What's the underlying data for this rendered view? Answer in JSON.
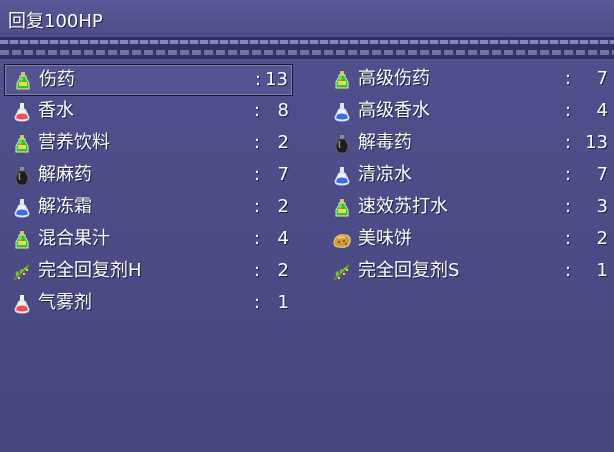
{
  "header": {
    "title": "回复100HP"
  },
  "inventory": {
    "left": [
      {
        "name": "伤药",
        "count": "13",
        "icon": "green-potion-icon"
      },
      {
        "name": "香水",
        "count": "8",
        "icon": "pink-perfume-icon"
      },
      {
        "name": "营养饮料",
        "count": "2",
        "icon": "green-potion-icon"
      },
      {
        "name": "解麻药",
        "count": "7",
        "icon": "black-potion-icon"
      },
      {
        "name": "解冻霜",
        "count": "2",
        "icon": "blue-potion-icon"
      },
      {
        "name": "混合果汁",
        "count": "4",
        "icon": "green-potion-icon"
      },
      {
        "name": "完全回复剂H",
        "count": "2",
        "icon": "herb-sprig-icon"
      },
      {
        "name": "气雾剂",
        "count": "1",
        "icon": "pink-perfume-icon"
      }
    ],
    "right": [
      {
        "name": "高级伤药",
        "count": "7",
        "icon": "green-potion-icon"
      },
      {
        "name": "高级香水",
        "count": "4",
        "icon": "blue-potion-icon"
      },
      {
        "name": "解毒药",
        "count": "13",
        "icon": "black-potion-icon"
      },
      {
        "name": "清凉水",
        "count": "7",
        "icon": "blue-potion-icon"
      },
      {
        "name": "速效苏打水",
        "count": "3",
        "icon": "green-potion-icon"
      },
      {
        "name": "美味饼",
        "count": "2",
        "icon": "cookie-icon"
      },
      {
        "name": "完全回复剂S",
        "count": "1",
        "icon": "herb-sprig-icon"
      }
    ]
  },
  "colors": {
    "background": "#4b4b86",
    "text": "#ffffff",
    "border_dark": "#2f3262"
  }
}
